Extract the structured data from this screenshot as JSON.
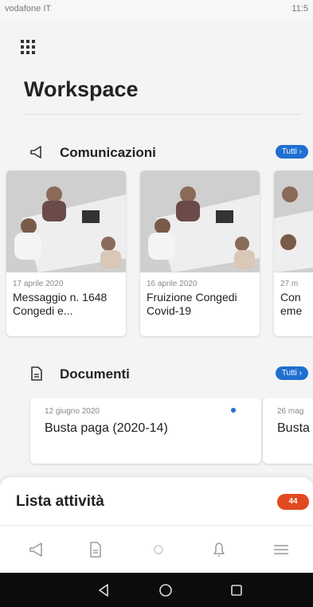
{
  "status_bar": {
    "carrier": "vodafone IT",
    "time": "11:5"
  },
  "page": {
    "title": "Workspace"
  },
  "communications": {
    "title": "Comunicazioni",
    "all_label": "Tutti",
    "cards": [
      {
        "date": "17 aprile 2020",
        "title": "Messaggio n. 1648 Congedi e..."
      },
      {
        "date": "16 aprile 2020",
        "title": "Fruizione Congedi Covid-19"
      },
      {
        "date": "27 m",
        "title": "Con eme"
      }
    ]
  },
  "documents": {
    "title": "Documenti",
    "all_label": "Tutti",
    "cards": [
      {
        "date": "12 giugno 2020",
        "title": "Busta paga (2020-14)"
      },
      {
        "date": "26 mag",
        "title": "Busta"
      }
    ]
  },
  "activities": {
    "title": "Lista attività",
    "count": "44"
  },
  "icons": {
    "menu": "grid-menu-icon",
    "communications": "megaphone-icon",
    "documents": "document-icon",
    "nav": [
      "megaphone-icon",
      "document-icon",
      "circle-icon",
      "bell-icon",
      "hamburger-icon"
    ],
    "system": [
      "back-triangle-icon",
      "home-circle-icon",
      "recents-square-icon"
    ]
  },
  "colors": {
    "accent": "#1f6fd0",
    "badge": "#e14a1f"
  }
}
